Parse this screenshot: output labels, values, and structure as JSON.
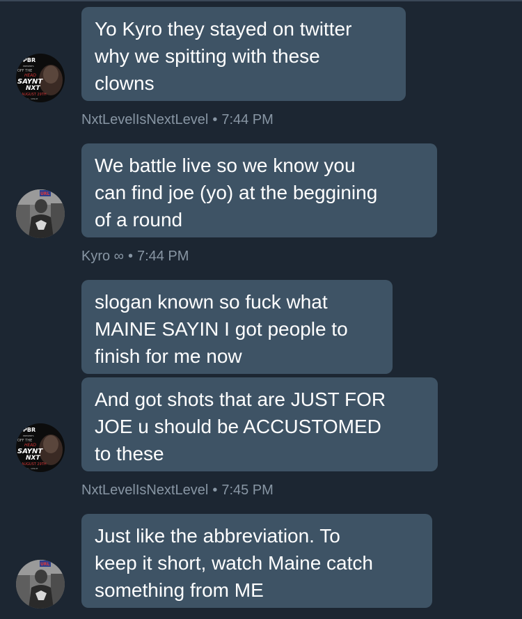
{
  "conversation": {
    "messages": [
      {
        "lines": [
          "Yo Kyro they stayed on twitter",
          "why we spitting with these",
          "clowns"
        ]
      },
      {
        "lines": [
          "We battle live so we know you",
          "can find joe (yo) at the beggining",
          "of a round"
        ]
      },
      {
        "lines": [
          "slogan known so fuck what",
          "MAINE SAYIN I got people to",
          "finish for me now"
        ]
      },
      {
        "lines": [
          "And got shots that are JUST FOR",
          "JOE u should be ACCUSTOMED",
          "to these"
        ]
      },
      {
        "lines": [
          "Just like the abbreviation. To",
          "keep it short, watch Maine catch",
          "something from ME"
        ]
      }
    ],
    "metas": [
      {
        "author": "NxtLevelIsNextLevel",
        "separator": "•",
        "time": "7:44 PM"
      },
      {
        "author": "Kyro ∞",
        "separator": "•",
        "time": "7:44 PM"
      },
      {
        "author": "NxtLevelIsNextLevel",
        "separator": "•",
        "time": "7:45 PM"
      }
    ],
    "avatars": {
      "nxt": {
        "icon": "poster-avatar",
        "texts": [
          "PBR",
          "PRESENTS",
          "OFF THE",
          "HEAD",
          "SAYNT",
          "NXT",
          "AUGUST 29TH",
          "CA - VENUE"
        ]
      },
      "kyro": {
        "icon": "photo-avatar",
        "texts": [
          "URL"
        ]
      }
    }
  },
  "colors": {
    "background": "#1c2632",
    "bubble": "#3e5365",
    "message_text": "#ffffff",
    "meta_text": "#8896a4"
  }
}
